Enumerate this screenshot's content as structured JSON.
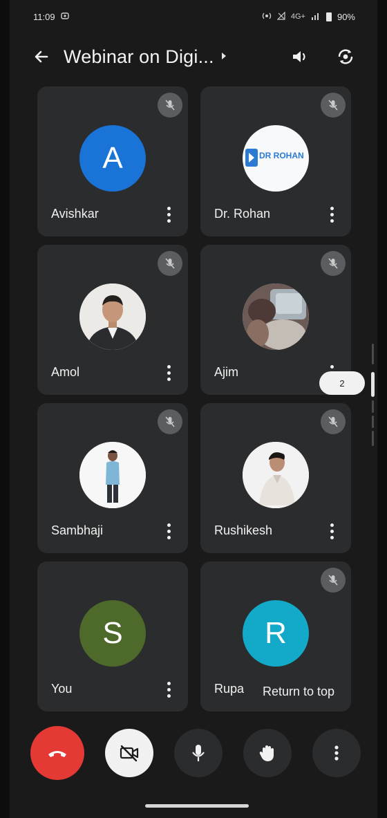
{
  "status": {
    "time": "11:09",
    "network": "4G+",
    "battery": "90%"
  },
  "header": {
    "title": "Webinar on Digi...",
    "back_icon": "back-arrow-icon",
    "audio_icon": "speaker-icon",
    "camera_switch_icon": "camera-switch-icon"
  },
  "colors": {
    "background": "#1a1a1b",
    "tile": "#2b2c2e",
    "avatar_a": "#1a73d6",
    "avatar_s": "#4d6a2a",
    "avatar_r": "#13a9c8",
    "end_call": "#e53935"
  },
  "participants": [
    {
      "name": "Avishkar",
      "initial": "A",
      "muted": true
    },
    {
      "name": "Dr. Rohan",
      "logo_text": "DR ROHAN",
      "muted": true
    },
    {
      "name": "Amol",
      "muted": true
    },
    {
      "name": "Ajim",
      "muted": true
    },
    {
      "name": "Sambhaji",
      "muted": true
    },
    {
      "name": "Rushikesh",
      "muted": true
    },
    {
      "name": "You",
      "initial": "S",
      "muted": false
    },
    {
      "name": "Rupa",
      "initial": "R",
      "muted": true
    }
  ],
  "pagination": {
    "current_page": "2"
  },
  "return_to_top": "Return to top",
  "controls": {
    "end_call_icon": "end-call-icon",
    "camera_off_icon": "camera-off-icon",
    "mic_icon": "mic-icon",
    "raise_hand_icon": "raise-hand-icon",
    "more_icon": "more-vert-icon"
  }
}
